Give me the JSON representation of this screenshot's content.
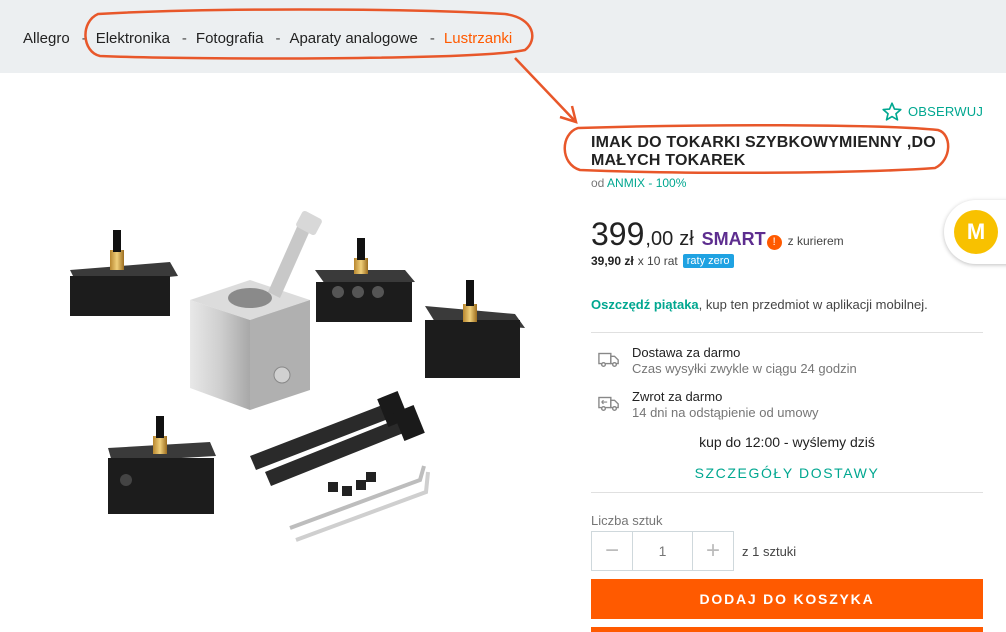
{
  "breadcrumb": {
    "items": [
      "Allegro",
      "Elektronika",
      "Fotografia",
      "Aparaty analogowe",
      "Lustrzanki"
    ],
    "separator": "-"
  },
  "watch": {
    "label": "OBSERWUJ",
    "icon": "star-outline-icon"
  },
  "product": {
    "title": "IMAK DO TOKARKI SZYBKOWYMIENNY ,DO MAŁYCH TOKAREK",
    "seller_prefix": "od",
    "seller_name": "ANMIX - 100%"
  },
  "price": {
    "main": "399",
    "fraction": ",00",
    "currency": "zł",
    "smart_label": "SMART",
    "smart_mark": "!",
    "courier": "z kurierem",
    "installment_amount": "39,90 zł",
    "installment_count": "x 10 rat",
    "installment_badge": "raty zero"
  },
  "badge": {
    "letter": "M"
  },
  "promo": {
    "highlight": "Oszczędź piątaka",
    "text": ", kup ten przedmiot w aplikacji mobilnej."
  },
  "delivery": {
    "title": "Dostawa za darmo",
    "subtitle": "Czas wysyłki zwykle w ciągu 24 godzin",
    "icon": "truck-icon"
  },
  "returns": {
    "title": "Zwrot za darmo",
    "subtitle": "14 dni na odstąpienie od umowy",
    "icon": "return-truck-icon"
  },
  "cutoff": "kup do 12:00 - wyślemy dziś",
  "details_link": "SZCZEGÓŁY DOSTAWY",
  "quantity": {
    "label": "Liczba sztuk",
    "value": "1",
    "minus": "−",
    "plus": "+",
    "of_text": "z 1 sztuki"
  },
  "cart_button": "DODAJ DO KOSZYKA",
  "colors": {
    "accent": "#ff5a00",
    "teal": "#00a790",
    "smart_purple": "#5d2d8f",
    "annotation": "#e8572a"
  }
}
